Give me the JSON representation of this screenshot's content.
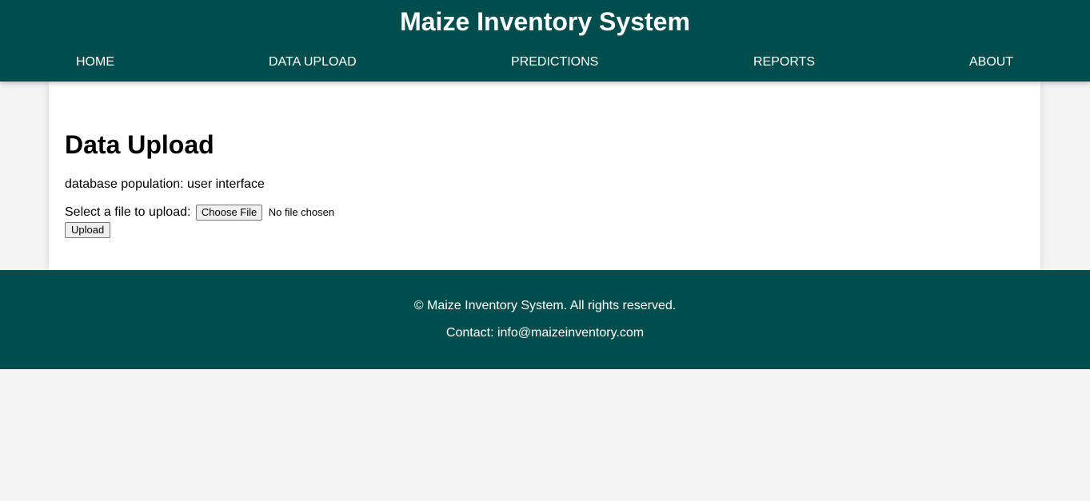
{
  "header": {
    "title": "Maize Inventory System",
    "nav": [
      "HOME",
      "DATA UPLOAD",
      "PREDICTIONS",
      "REPORTS",
      "ABOUT"
    ]
  },
  "main": {
    "title": "Data Upload",
    "description": "database population: user interface",
    "upload_label": "Select a file to upload:",
    "choose_file_label": "Choose File",
    "file_status": "No file chosen",
    "upload_button": "Upload"
  },
  "footer": {
    "copyright": "© Maize Inventory System. All rights reserved.",
    "contact": "Contact: info@maizeinventory.com"
  },
  "colors": {
    "header_bg": "#004d4d",
    "page_bg": "#f3f3f3",
    "card_bg": "#ffffff"
  }
}
